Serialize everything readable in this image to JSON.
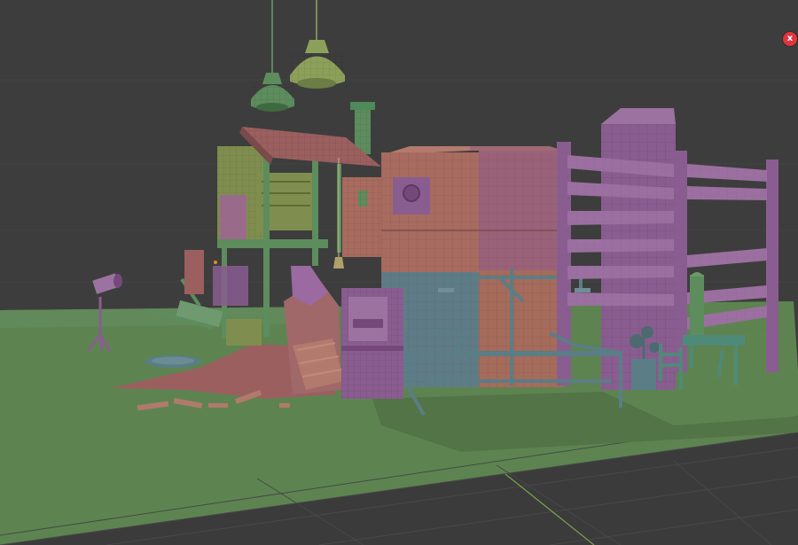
{
  "viewport": {
    "name": "3D viewport",
    "shading": "solid-random-colors",
    "grid": true,
    "background": "#3d3d3d",
    "ground_color": "#5d8450"
  },
  "colors": {
    "pink": "#9b5f5f",
    "pink_light": "#b47a6e",
    "purple": "#8a5d90",
    "purple_light": "#a278a6",
    "olive": "#7f8e4e",
    "green": "#5d8c5d",
    "green_dark": "#4e7a4f",
    "teal": "#4f8a78",
    "slate": "#5a7d86",
    "steel": "#5f7c8a"
  },
  "close_button": {
    "label": "x",
    "icon": "close-icon",
    "color": "#e2343f"
  }
}
